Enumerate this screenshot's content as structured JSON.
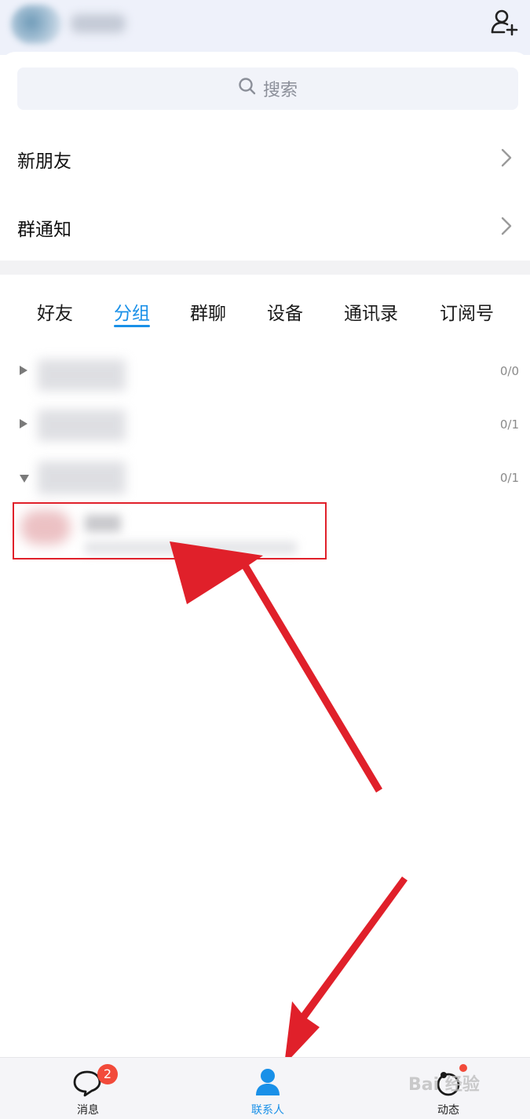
{
  "header": {
    "add_friend_icon": "add-person-icon"
  },
  "search": {
    "placeholder": "搜索",
    "icon": "search-icon"
  },
  "entries": [
    {
      "label": "新朋友",
      "icon": "chevron-right-icon"
    },
    {
      "label": "群通知",
      "icon": "chevron-right-icon"
    }
  ],
  "tabs": [
    {
      "label": "好友",
      "active": false
    },
    {
      "label": "分组",
      "active": true
    },
    {
      "label": "群聊",
      "active": false
    },
    {
      "label": "设备",
      "active": false
    },
    {
      "label": "通讯录",
      "active": false
    },
    {
      "label": "订阅号",
      "active": false
    }
  ],
  "groups": [
    {
      "count": "0/0",
      "expanded": false
    },
    {
      "count": "0/1",
      "expanded": false
    },
    {
      "count": "0/1",
      "expanded": true
    }
  ],
  "bottom_nav": [
    {
      "label": "消息",
      "icon": "chat-bubble-icon",
      "badge": "2",
      "active": false
    },
    {
      "label": "联系人",
      "icon": "contact-person-icon",
      "active": true
    },
    {
      "label": "动态",
      "icon": "feed-star-icon",
      "dot": true,
      "active": false
    }
  ],
  "watermark": "Bai 经验",
  "colors": {
    "accent": "#1990e8",
    "badge": "#f24a3a",
    "annotation": "#e0202a"
  }
}
